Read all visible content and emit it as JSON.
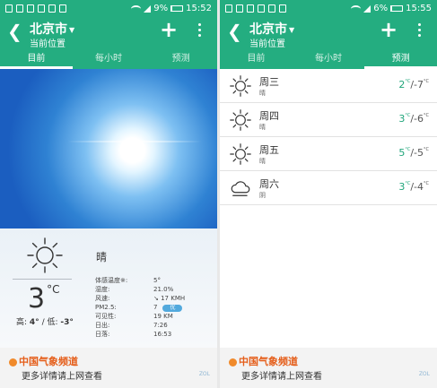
{
  "colors": {
    "accent": "#24ad80",
    "high_temp": "#1fa57a",
    "pm_badge": "#52a9dd"
  },
  "left": {
    "status": {
      "battery": "9%",
      "battery_level": 0.09,
      "time": "15:52"
    },
    "header": {
      "city": "北京市",
      "location": "当前位置",
      "add_icon": "plus-icon",
      "menu_icon": "more-vert-icon"
    },
    "tabs": [
      {
        "label": "目前",
        "active": true
      },
      {
        "label": "每小时",
        "active": false
      },
      {
        "label": "预测",
        "active": false
      }
    ],
    "current": {
      "condition": "晴",
      "icon": "sun-icon",
      "temp": "3",
      "unit": "°C",
      "hi_label": "高:",
      "hi": "4°",
      "lo_label": "/ 低:",
      "lo": "-3°",
      "details": [
        {
          "label": "体感温度※:",
          "value": "5°"
        },
        {
          "label": "湿度:",
          "value": "21.0%"
        },
        {
          "label": "风速:",
          "value": "↘ 17 KMH"
        },
        {
          "label": "PM2.5:",
          "value": "7",
          "badge": "优"
        },
        {
          "label": "可见性:",
          "value": "19 KM"
        },
        {
          "label": "日出:",
          "value": "7:26"
        },
        {
          "label": "日落:",
          "value": "16:53"
        }
      ]
    },
    "footer": {
      "brand": "中国气象频道",
      "more": "更多详情请上网查看",
      "watermark": "ZOL"
    }
  },
  "right": {
    "status": {
      "battery": "6%",
      "battery_level": 0.06,
      "time": "15:55"
    },
    "header": {
      "city": "北京市",
      "location": "当前位置",
      "add_icon": "plus-icon",
      "menu_icon": "more-vert-icon"
    },
    "tabs": [
      {
        "label": "目前",
        "active": false
      },
      {
        "label": "每小时",
        "active": false
      },
      {
        "label": "预测",
        "active": true
      }
    ],
    "forecast": [
      {
        "day": "周三",
        "cond": "晴",
        "icon": "sun-icon",
        "hi": "2",
        "lo": "-7",
        "unit": "°C"
      },
      {
        "day": "周四",
        "cond": "晴",
        "icon": "sun-icon",
        "hi": "3",
        "lo": "-6",
        "unit": "°C"
      },
      {
        "day": "周五",
        "cond": "晴",
        "icon": "sun-icon",
        "hi": "5",
        "lo": "-5",
        "unit": "°C"
      },
      {
        "day": "周六",
        "cond": "阴",
        "icon": "cloudy-icon",
        "hi": "3",
        "lo": "-4",
        "unit": "°C"
      }
    ],
    "footer": {
      "brand": "中国气象频道",
      "more": "更多详情请上网查看",
      "watermark": "ZOL"
    }
  }
}
